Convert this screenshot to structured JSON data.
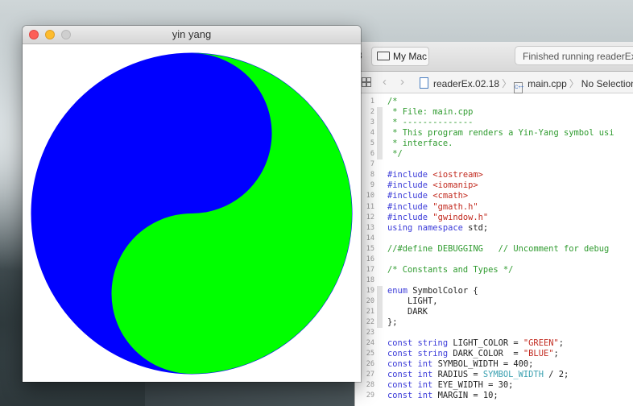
{
  "yin_yang_window": {
    "title": "yin yang",
    "light_color": "#00ff00",
    "dark_color": "#0000ff"
  },
  "xcode": {
    "toolbar": {
      "scheme_fragment": "8",
      "destination": "My Mac",
      "activity_status": "Finished running readerEx."
    },
    "jumpbar": {
      "project": "readerEx.02.18",
      "file": "main.cpp",
      "selection": "No Selection"
    },
    "code_lines": [
      {
        "n": "1",
        "tokens": [
          {
            "t": "/*",
            "c": "com"
          }
        ]
      },
      {
        "n": "2",
        "tokens": [
          {
            "t": " * File: main.cpp",
            "c": "com"
          }
        ]
      },
      {
        "n": "3",
        "tokens": [
          {
            "t": " * --------------",
            "c": "com"
          }
        ]
      },
      {
        "n": "4",
        "tokens": [
          {
            "t": " * This program renders a Yin-Yang symbol usi",
            "c": "com"
          }
        ]
      },
      {
        "n": "5",
        "tokens": [
          {
            "t": " * interface.",
            "c": "com"
          }
        ]
      },
      {
        "n": "6",
        "tokens": [
          {
            "t": " */",
            "c": "com"
          }
        ]
      },
      {
        "n": "7",
        "tokens": []
      },
      {
        "n": "8",
        "tokens": [
          {
            "t": "#include ",
            "c": "kw"
          },
          {
            "t": "<iostream>",
            "c": "str"
          }
        ]
      },
      {
        "n": "9",
        "tokens": [
          {
            "t": "#include ",
            "c": "kw"
          },
          {
            "t": "<iomanip>",
            "c": "str"
          }
        ]
      },
      {
        "n": "10",
        "tokens": [
          {
            "t": "#include ",
            "c": "kw"
          },
          {
            "t": "<cmath>",
            "c": "str"
          }
        ]
      },
      {
        "n": "11",
        "tokens": [
          {
            "t": "#include ",
            "c": "kw"
          },
          {
            "t": "\"gmath.h\"",
            "c": "str"
          }
        ]
      },
      {
        "n": "12",
        "tokens": [
          {
            "t": "#include ",
            "c": "kw"
          },
          {
            "t": "\"gwindow.h\"",
            "c": "str"
          }
        ]
      },
      {
        "n": "13",
        "tokens": [
          {
            "t": "using namespace ",
            "c": "kw"
          },
          {
            "t": "std;",
            "c": "id"
          }
        ]
      },
      {
        "n": "14",
        "tokens": []
      },
      {
        "n": "15",
        "tokens": [
          {
            "t": "//#define DEBUGGING   // Uncomment for debug",
            "c": "com"
          }
        ]
      },
      {
        "n": "16",
        "tokens": []
      },
      {
        "n": "17",
        "tokens": [
          {
            "t": "/* Constants and Types */",
            "c": "com"
          }
        ]
      },
      {
        "n": "18",
        "tokens": []
      },
      {
        "n": "19",
        "tokens": [
          {
            "t": "enum ",
            "c": "kw"
          },
          {
            "t": "SymbolColor {",
            "c": "id"
          }
        ]
      },
      {
        "n": "20",
        "tokens": [
          {
            "t": "    LIGHT,",
            "c": "id"
          }
        ]
      },
      {
        "n": "21",
        "tokens": [
          {
            "t": "    DARK",
            "c": "id"
          }
        ]
      },
      {
        "n": "22",
        "tokens": [
          {
            "t": "};",
            "c": "id"
          }
        ]
      },
      {
        "n": "23",
        "tokens": []
      },
      {
        "n": "24",
        "tokens": [
          {
            "t": "const string ",
            "c": "kw"
          },
          {
            "t": "LIGHT_COLOR = ",
            "c": "id"
          },
          {
            "t": "\"GREEN\"",
            "c": "str"
          },
          {
            "t": ";",
            "c": "id"
          }
        ]
      },
      {
        "n": "25",
        "tokens": [
          {
            "t": "const string ",
            "c": "kw"
          },
          {
            "t": "DARK_COLOR  = ",
            "c": "id"
          },
          {
            "t": "\"BLUE\"",
            "c": "str"
          },
          {
            "t": ";",
            "c": "id"
          }
        ]
      },
      {
        "n": "26",
        "tokens": [
          {
            "t": "const int ",
            "c": "kw"
          },
          {
            "t": "SYMBOL_WIDTH = 400;",
            "c": "id"
          }
        ]
      },
      {
        "n": "27",
        "tokens": [
          {
            "t": "const int ",
            "c": "kw"
          },
          {
            "t": "RADIUS = ",
            "c": "id"
          },
          {
            "t": "SYMBOL_WIDTH",
            "c": "mac"
          },
          {
            "t": " / 2;",
            "c": "id"
          }
        ]
      },
      {
        "n": "28",
        "tokens": [
          {
            "t": "const int ",
            "c": "kw"
          },
          {
            "t": "EYE_WIDTH = 30;",
            "c": "id"
          }
        ]
      },
      {
        "n": "29",
        "tokens": [
          {
            "t": "const int ",
            "c": "kw"
          },
          {
            "t": "MARGIN = 10;",
            "c": "id"
          }
        ]
      }
    ],
    "folded_lines": [
      "2",
      "3",
      "4",
      "5",
      "6",
      "19",
      "20",
      "21",
      "22"
    ]
  }
}
